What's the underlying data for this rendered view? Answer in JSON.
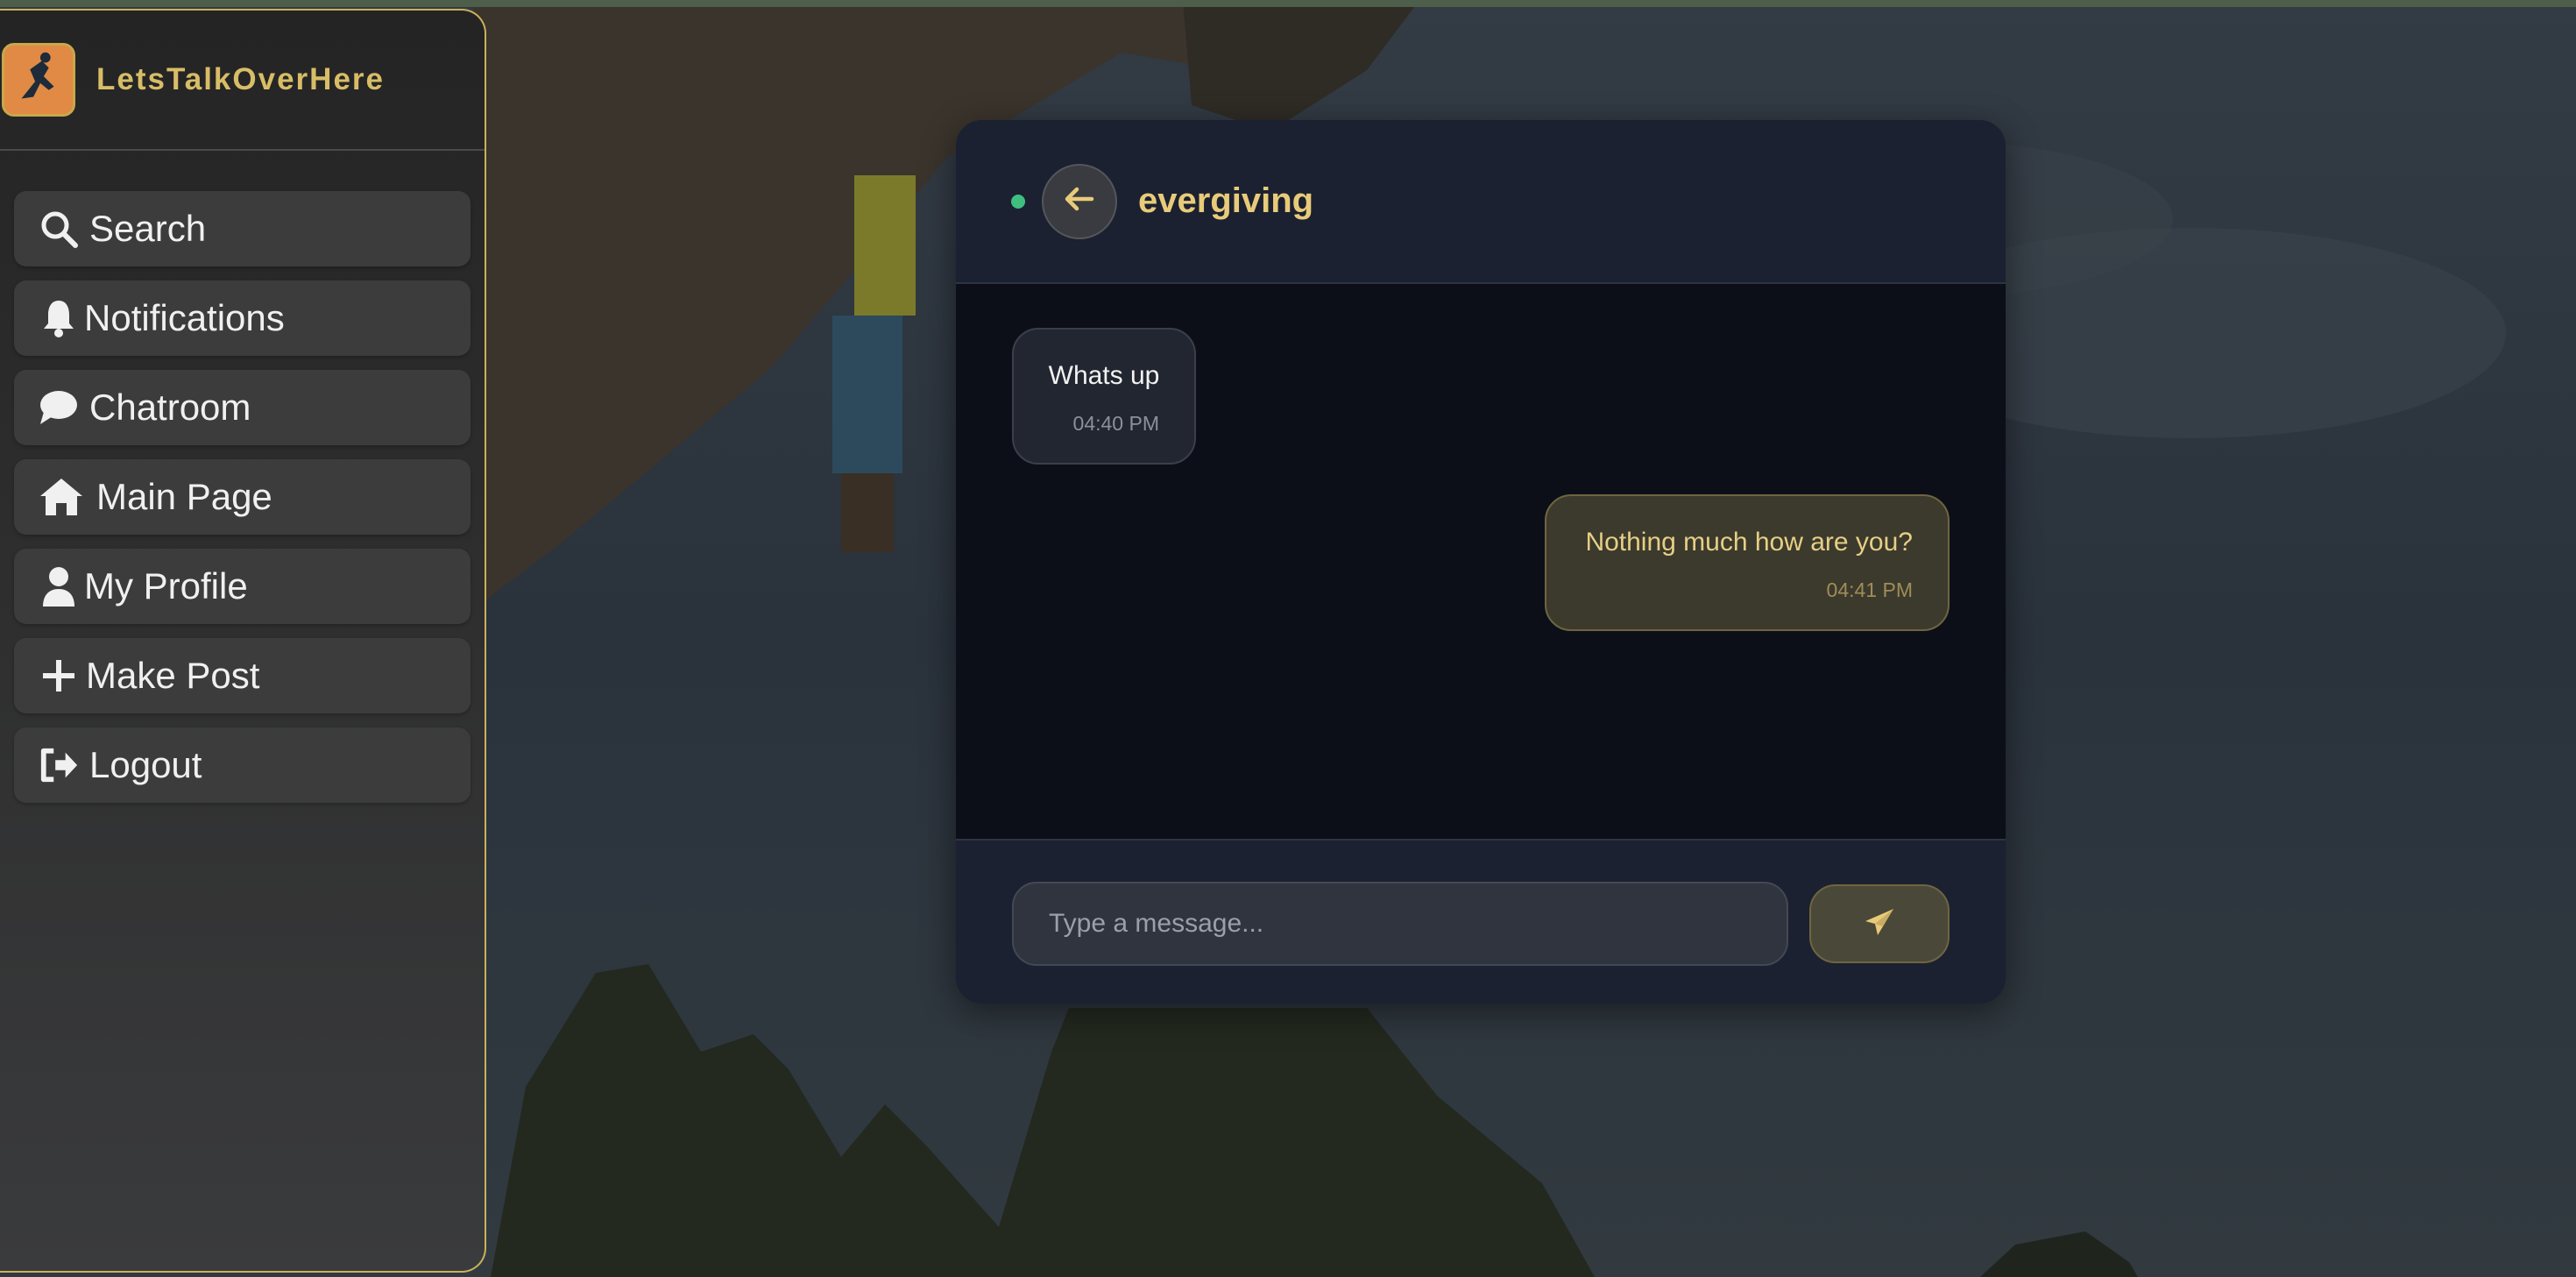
{
  "app": {
    "name": "LetsTalkOverHere",
    "logo_icon": "climber-logo-icon"
  },
  "sidebar": {
    "items": [
      {
        "label": "Search",
        "icon": "search-icon"
      },
      {
        "label": "Notifications",
        "icon": "bell-icon"
      },
      {
        "label": "Chatroom",
        "icon": "chat-bubble-icon"
      },
      {
        "label": "Main Page",
        "icon": "home-icon"
      },
      {
        "label": "My Profile",
        "icon": "user-icon"
      },
      {
        "label": "Make Post",
        "icon": "plus-icon"
      },
      {
        "label": "Logout",
        "icon": "logout-icon"
      }
    ]
  },
  "chat": {
    "username": "evergiving",
    "online": true,
    "messages": [
      {
        "direction": "incoming",
        "text": "Whats up",
        "time": "04:40 PM"
      },
      {
        "direction": "outgoing",
        "text": "Nothing much how are you?",
        "time": "04:41 PM"
      }
    ],
    "composer": {
      "placeholder": "Type a message...",
      "value": ""
    }
  },
  "colors": {
    "accent": "#d8bd67",
    "online": "#3fbf7f",
    "panel": "#1a1f2b"
  }
}
